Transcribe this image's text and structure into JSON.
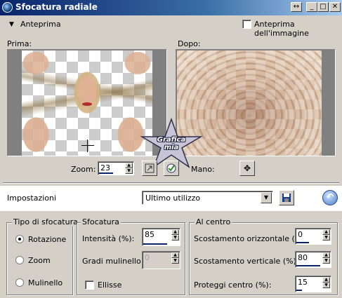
{
  "window": {
    "title": "Sfocatura radiale"
  },
  "title_buttons": {
    "restore": "↔",
    "minimize": "_",
    "maximize": "□",
    "close": "✕"
  },
  "preview": {
    "toggle_label": "Anteprima",
    "image_preview_label": "Anteprima dell'immagine"
  },
  "before_label": "Prima:",
  "after_label": "Dopo:",
  "zoom": {
    "label": "Zoom:",
    "value": "23"
  },
  "pan_label": "Mano:",
  "watermark": {
    "line1": "Grafica",
    "line2": "mia"
  },
  "settings": {
    "label": "Impostazioni",
    "selected": "Ultimo utilizzo"
  },
  "blur_type": {
    "legend": "Tipo di sfocatura",
    "options": [
      "Rotazione",
      "Zoom",
      "Mulinello"
    ],
    "selected": 0
  },
  "blur": {
    "legend": "Sfocatura",
    "intensity_label": "Intensità (%):",
    "intensity_value": "85",
    "twist_label": "Gradi mulinello:",
    "twist_value": "0",
    "elliptical_label": "Ellisse"
  },
  "center": {
    "legend": "Al centro",
    "h_offset_label": "Scostamento orizzontale (%):",
    "h_offset_value": "0",
    "v_offset_label": "Scostamento verticale (%):",
    "v_offset_value": "80",
    "protect_label": "Proteggi centro (%):",
    "protect_value": "15"
  },
  "colors": {
    "titlebar": "#0a246a",
    "face": "#d4d0c8",
    "accent": "#0a246a"
  }
}
